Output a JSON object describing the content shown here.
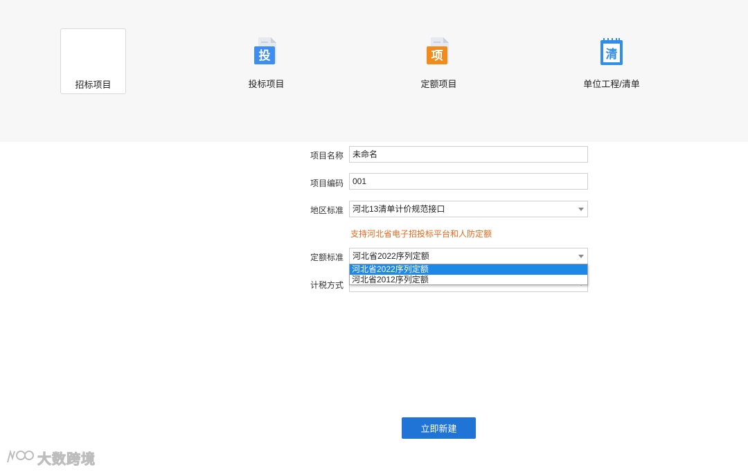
{
  "project_types": [
    {
      "label": "招标项目",
      "selected": true
    },
    {
      "label": "投标项目",
      "icon_char": "投",
      "icon_color": "#3d8ef0"
    },
    {
      "label": "定额项目",
      "icon_char": "项",
      "icon_color": "#f08c1e"
    },
    {
      "label": "单位工程/清单",
      "icon_char": "清",
      "icon_color": "#2f8ee8"
    }
  ],
  "form": {
    "project_name_label": "项目名称",
    "project_name_value": "未命名",
    "project_code_label": "项目编码",
    "project_code_value": "001",
    "region_label": "地区标准",
    "region_value": "河北13清单计价规范接口",
    "region_hint": "支持河北省电子招投标平台和人防定额",
    "quota_label": "定额标准",
    "quota_value": "河北省2022序列定额",
    "quota_options": [
      "河北省2022序列定额",
      "河北省2012序列定额"
    ],
    "tax_label": "计税方式"
  },
  "create_button": "立即新建",
  "watermark": "大数跨境",
  "colors": {
    "accent": "#1f74d6",
    "hint": "#e8681b",
    "dropdown_highlight": "#1e88e5"
  }
}
